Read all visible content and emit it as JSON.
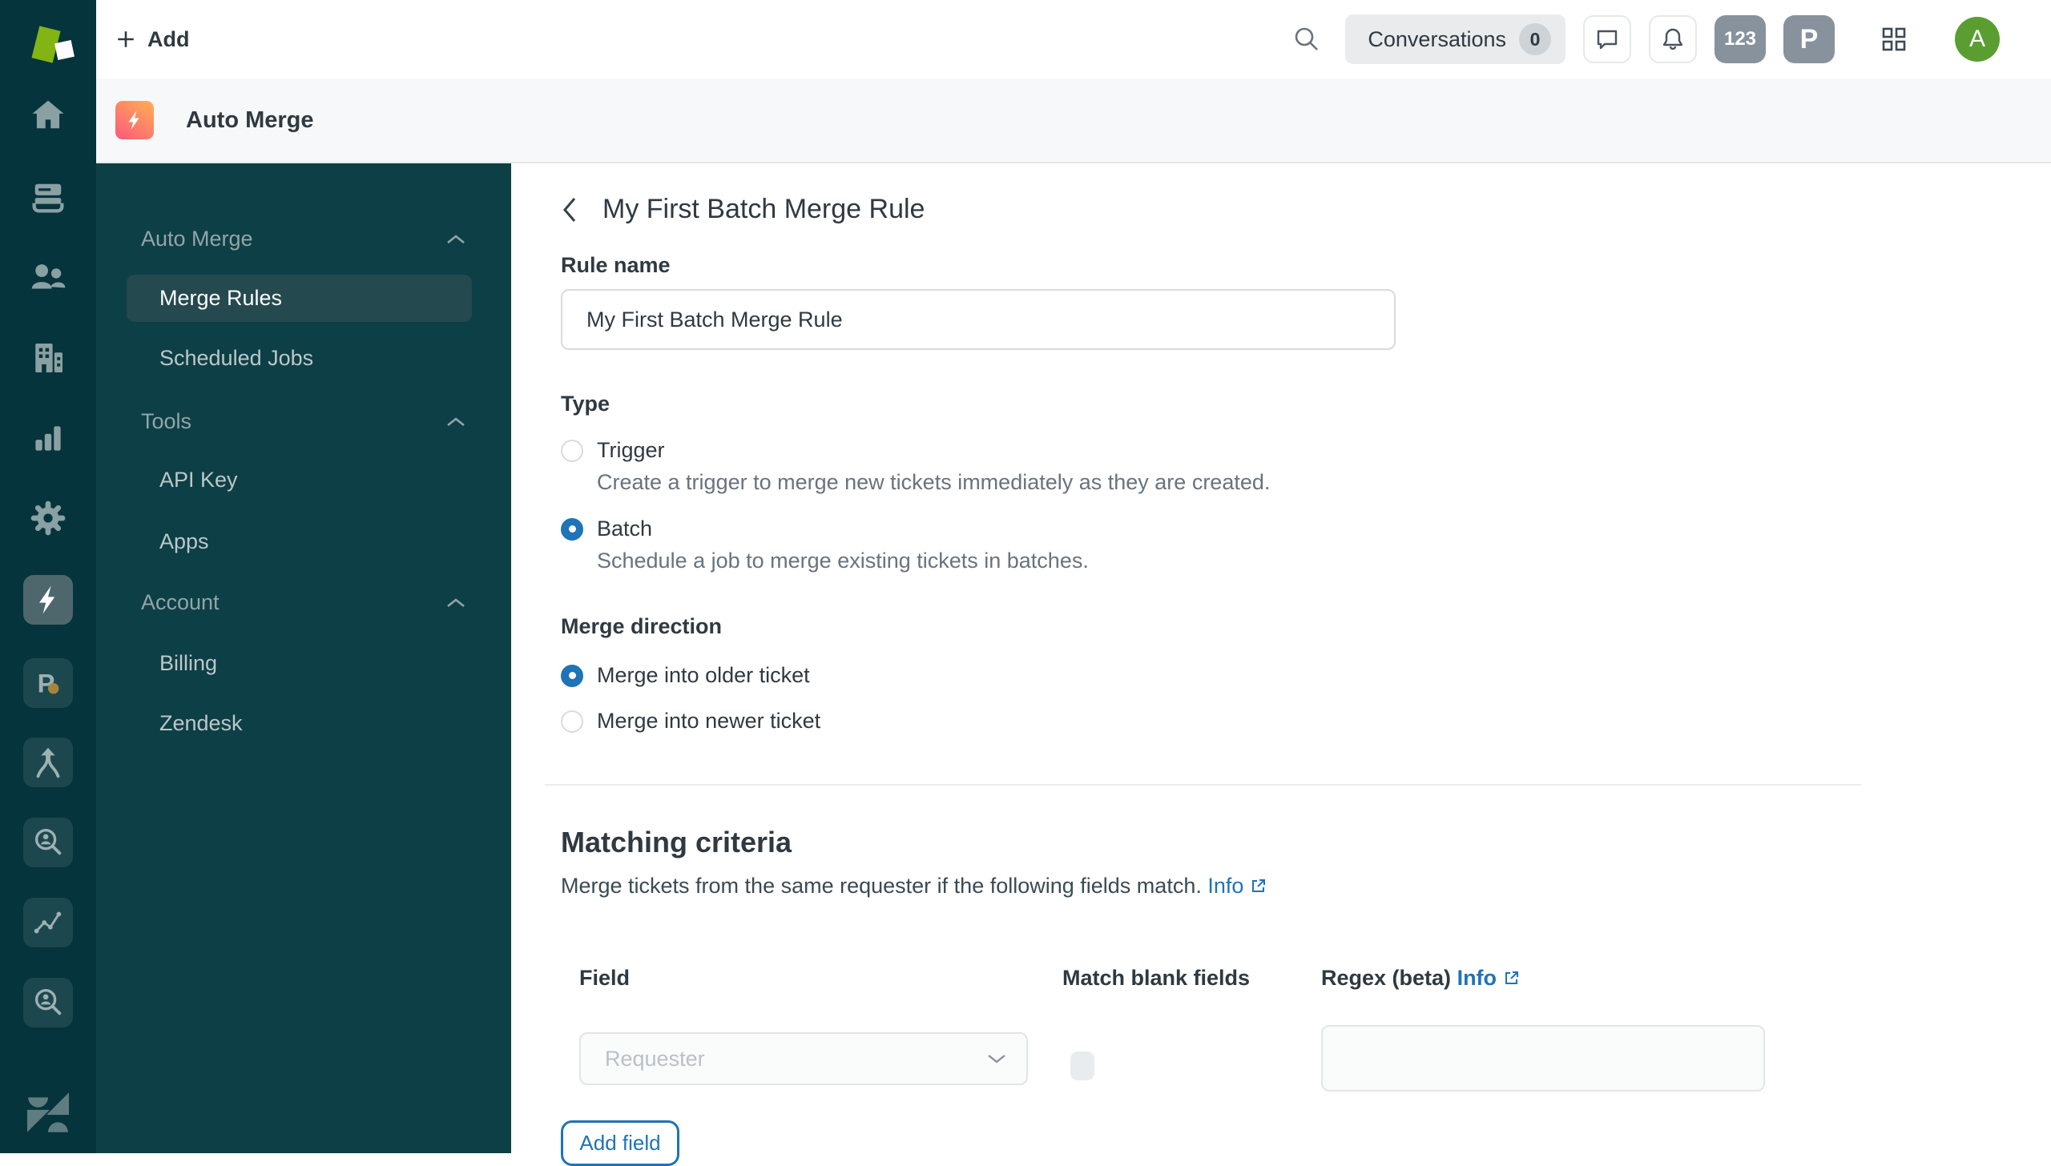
{
  "colors": {
    "accent_blue": "#1f73b7",
    "rail_bg": "#06343c",
    "panel_bg": "#0d3f46",
    "app_gradient_start": "#ffb052",
    "app_gradient_end": "#fc587b",
    "avatar_green": "#5a9e31",
    "badge_gray": "#87929d",
    "logo_green": "#82b414"
  },
  "header": {
    "add_label": "Add",
    "conversations": {
      "label": "Conversations",
      "count": "0"
    },
    "badge_numbers": "123",
    "badge_p": "P",
    "avatar_initial": "A"
  },
  "appbar": {
    "title": "Auto Merge"
  },
  "rail_icons": [
    "brand-logo",
    "home",
    "tickets",
    "customers",
    "organizations",
    "reporting",
    "settings",
    "auto-merge-lightning",
    "p-app",
    "merge-tool",
    "user-search",
    "trend-lines",
    "user-search",
    "zendesk-logo"
  ],
  "nav": {
    "sections": [
      {
        "label": "Auto Merge",
        "items": [
          {
            "label": "Merge Rules",
            "active": true
          },
          {
            "label": "Scheduled Jobs",
            "active": false
          }
        ]
      },
      {
        "label": "Tools",
        "items": [
          {
            "label": "API Key",
            "active": false
          },
          {
            "label": "Apps",
            "active": false
          }
        ]
      },
      {
        "label": "Account",
        "items": [
          {
            "label": "Billing",
            "active": false
          },
          {
            "label": "Zendesk",
            "active": false
          }
        ]
      }
    ]
  },
  "main": {
    "title": "My First Batch Merge Rule",
    "rule_name": {
      "label": "Rule name",
      "value": "My First Batch Merge Rule"
    },
    "type": {
      "label": "Type",
      "options": [
        {
          "label": "Trigger",
          "desc": "Create a trigger to merge new tickets immediately as they are created.",
          "selected": false
        },
        {
          "label": "Batch",
          "desc": "Schedule a job to merge existing tickets in batches.",
          "selected": true
        }
      ]
    },
    "direction": {
      "label": "Merge direction",
      "options": [
        {
          "label": "Merge into older ticket",
          "selected": true
        },
        {
          "label": "Merge into newer ticket",
          "selected": false
        }
      ]
    },
    "criteria": {
      "heading": "Matching criteria",
      "desc": "Merge tickets from the same requester if the following fields match.",
      "info_label": "Info",
      "columns": {
        "field": "Field",
        "blank": "Match blank fields",
        "regex": "Regex (beta)",
        "regex_info": "Info"
      },
      "field_value": "Requester",
      "regex_value": "",
      "add_field_label": "Add field"
    }
  }
}
